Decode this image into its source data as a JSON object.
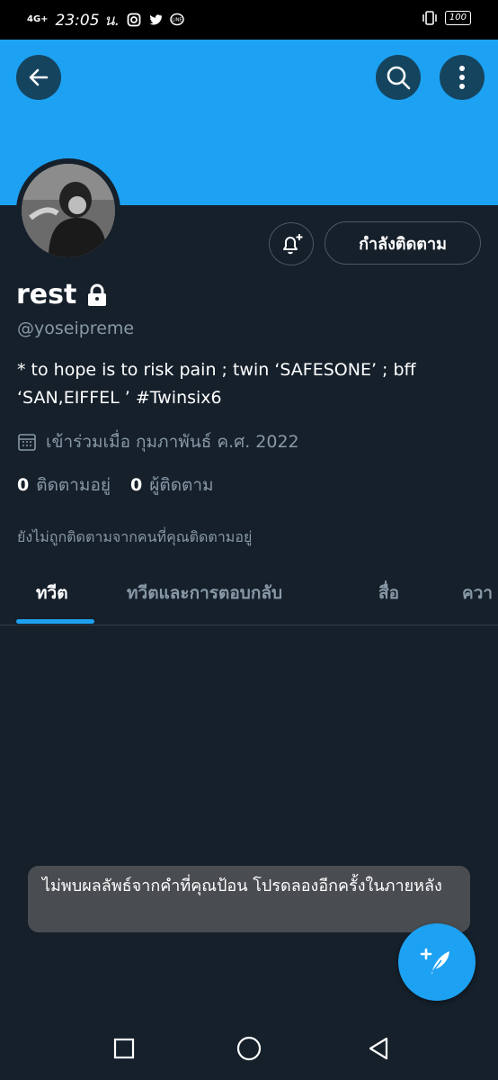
{
  "status_bar": {
    "network": "4G+",
    "time": "23:05 น.",
    "battery": "100",
    "icons": [
      "signal-icon",
      "instagram-icon",
      "twitter-icon",
      "line-icon",
      "vibrate-icon",
      "battery-icon"
    ]
  },
  "header": {
    "back_icon": "back-arrow-icon",
    "search_icon": "search-icon",
    "more_icon": "more-vertical-icon",
    "banner_color": "#1da1f2"
  },
  "profile": {
    "name": "rest",
    "locked_icon": "lock-icon",
    "handle": "@yoseipreme",
    "bio": "* to hope is to risk pain ; twin ‘SAFESONE’ ; bff ‘SAN,EIFFEL ’ #Twinsix6",
    "joined": "เข้าร่วมเมื่อ กุมภาพันธ์ ค.ศ. 2022",
    "following_count": "0",
    "following_label": "ติดตามอยู่",
    "followers_count": "0",
    "followers_label": "ผู้ติดตาม",
    "not_followed_text": "ยังไม่ถูกติดตามจากคนที่คุณติดตามอยู่",
    "following_button": "กำลังติดตาม"
  },
  "tabs": [
    {
      "label": "ทวีต",
      "active": true
    },
    {
      "label": "ทวีตและการตอบกลับ",
      "active": false
    },
    {
      "label": "สื่อ",
      "active": false
    },
    {
      "label": "ควา",
      "active": false
    }
  ],
  "toast": {
    "message": "ไม่พบผลลัพธ์จากคำที่คุณป้อน โปรดลองอีกครั้งในภายหลัง"
  },
  "colors": {
    "background": "#15202b",
    "accent": "#1da1f2",
    "secondary_text": "#8899a6"
  }
}
